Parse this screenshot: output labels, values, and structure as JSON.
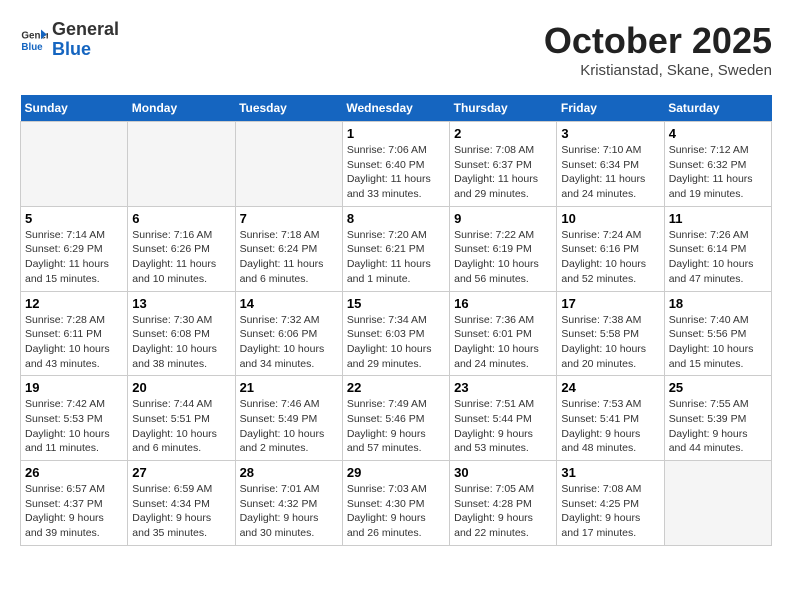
{
  "header": {
    "logo_general": "General",
    "logo_blue": "Blue",
    "month_title": "October 2025",
    "location": "Kristianstad, Skane, Sweden"
  },
  "days_of_week": [
    "Sunday",
    "Monday",
    "Tuesday",
    "Wednesday",
    "Thursday",
    "Friday",
    "Saturday"
  ],
  "weeks": [
    [
      {
        "day": "",
        "empty": true
      },
      {
        "day": "",
        "empty": true
      },
      {
        "day": "",
        "empty": true
      },
      {
        "day": "1",
        "sunrise": "7:06 AM",
        "sunset": "6:40 PM",
        "daylight": "11 hours and 33 minutes."
      },
      {
        "day": "2",
        "sunrise": "7:08 AM",
        "sunset": "6:37 PM",
        "daylight": "11 hours and 29 minutes."
      },
      {
        "day": "3",
        "sunrise": "7:10 AM",
        "sunset": "6:34 PM",
        "daylight": "11 hours and 24 minutes."
      },
      {
        "day": "4",
        "sunrise": "7:12 AM",
        "sunset": "6:32 PM",
        "daylight": "11 hours and 19 minutes."
      }
    ],
    [
      {
        "day": "5",
        "sunrise": "7:14 AM",
        "sunset": "6:29 PM",
        "daylight": "11 hours and 15 minutes."
      },
      {
        "day": "6",
        "sunrise": "7:16 AM",
        "sunset": "6:26 PM",
        "daylight": "11 hours and 10 minutes."
      },
      {
        "day": "7",
        "sunrise": "7:18 AM",
        "sunset": "6:24 PM",
        "daylight": "11 hours and 6 minutes."
      },
      {
        "day": "8",
        "sunrise": "7:20 AM",
        "sunset": "6:21 PM",
        "daylight": "11 hours and 1 minute."
      },
      {
        "day": "9",
        "sunrise": "7:22 AM",
        "sunset": "6:19 PM",
        "daylight": "10 hours and 56 minutes."
      },
      {
        "day": "10",
        "sunrise": "7:24 AM",
        "sunset": "6:16 PM",
        "daylight": "10 hours and 52 minutes."
      },
      {
        "day": "11",
        "sunrise": "7:26 AM",
        "sunset": "6:14 PM",
        "daylight": "10 hours and 47 minutes."
      }
    ],
    [
      {
        "day": "12",
        "sunrise": "7:28 AM",
        "sunset": "6:11 PM",
        "daylight": "10 hours and 43 minutes."
      },
      {
        "day": "13",
        "sunrise": "7:30 AM",
        "sunset": "6:08 PM",
        "daylight": "10 hours and 38 minutes."
      },
      {
        "day": "14",
        "sunrise": "7:32 AM",
        "sunset": "6:06 PM",
        "daylight": "10 hours and 34 minutes."
      },
      {
        "day": "15",
        "sunrise": "7:34 AM",
        "sunset": "6:03 PM",
        "daylight": "10 hours and 29 minutes."
      },
      {
        "day": "16",
        "sunrise": "7:36 AM",
        "sunset": "6:01 PM",
        "daylight": "10 hours and 24 minutes."
      },
      {
        "day": "17",
        "sunrise": "7:38 AM",
        "sunset": "5:58 PM",
        "daylight": "10 hours and 20 minutes."
      },
      {
        "day": "18",
        "sunrise": "7:40 AM",
        "sunset": "5:56 PM",
        "daylight": "10 hours and 15 minutes."
      }
    ],
    [
      {
        "day": "19",
        "sunrise": "7:42 AM",
        "sunset": "5:53 PM",
        "daylight": "10 hours and 11 minutes."
      },
      {
        "day": "20",
        "sunrise": "7:44 AM",
        "sunset": "5:51 PM",
        "daylight": "10 hours and 6 minutes."
      },
      {
        "day": "21",
        "sunrise": "7:46 AM",
        "sunset": "5:49 PM",
        "daylight": "10 hours and 2 minutes."
      },
      {
        "day": "22",
        "sunrise": "7:49 AM",
        "sunset": "5:46 PM",
        "daylight": "9 hours and 57 minutes."
      },
      {
        "day": "23",
        "sunrise": "7:51 AM",
        "sunset": "5:44 PM",
        "daylight": "9 hours and 53 minutes."
      },
      {
        "day": "24",
        "sunrise": "7:53 AM",
        "sunset": "5:41 PM",
        "daylight": "9 hours and 48 minutes."
      },
      {
        "day": "25",
        "sunrise": "7:55 AM",
        "sunset": "5:39 PM",
        "daylight": "9 hours and 44 minutes."
      }
    ],
    [
      {
        "day": "26",
        "sunrise": "6:57 AM",
        "sunset": "4:37 PM",
        "daylight": "9 hours and 39 minutes."
      },
      {
        "day": "27",
        "sunrise": "6:59 AM",
        "sunset": "4:34 PM",
        "daylight": "9 hours and 35 minutes."
      },
      {
        "day": "28",
        "sunrise": "7:01 AM",
        "sunset": "4:32 PM",
        "daylight": "9 hours and 30 minutes."
      },
      {
        "day": "29",
        "sunrise": "7:03 AM",
        "sunset": "4:30 PM",
        "daylight": "9 hours and 26 minutes."
      },
      {
        "day": "30",
        "sunrise": "7:05 AM",
        "sunset": "4:28 PM",
        "daylight": "9 hours and 22 minutes."
      },
      {
        "day": "31",
        "sunrise": "7:08 AM",
        "sunset": "4:25 PM",
        "daylight": "9 hours and 17 minutes."
      },
      {
        "day": "",
        "empty": true
      }
    ]
  ]
}
